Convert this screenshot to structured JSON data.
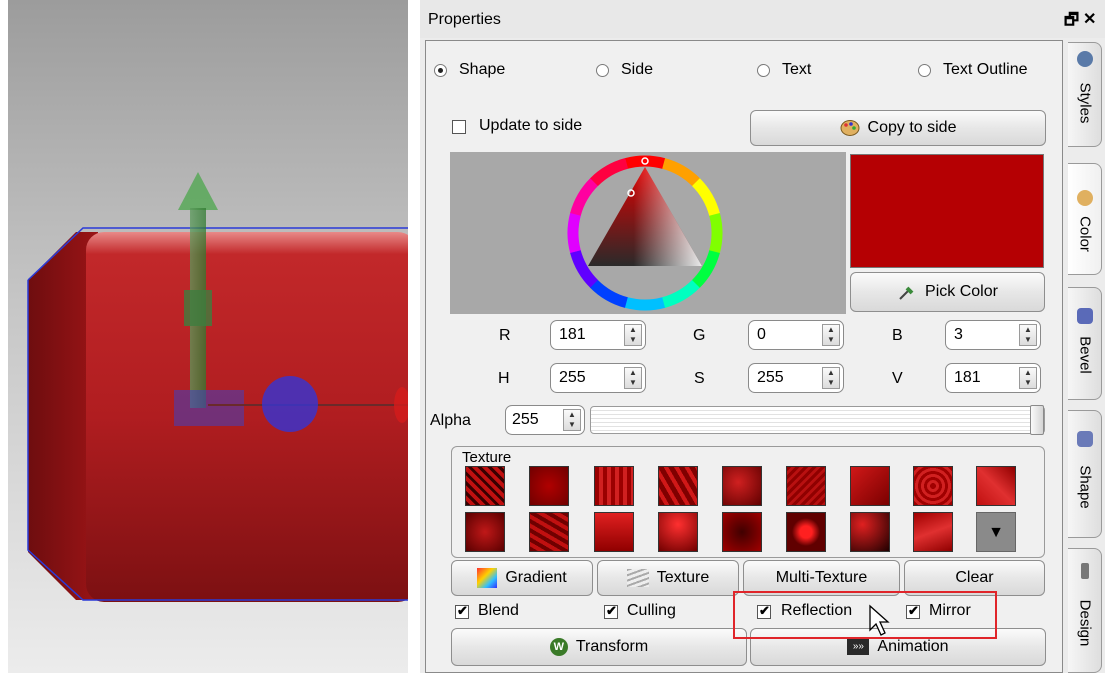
{
  "panel": {
    "title": "Properties",
    "float_glyph": "🗗",
    "close_glyph": "✕"
  },
  "target_radios": [
    {
      "label": "Shape",
      "selected": true
    },
    {
      "label": "Side",
      "selected": false
    },
    {
      "label": "Text",
      "selected": false
    },
    {
      "label": "Text Outline",
      "selected": false
    }
  ],
  "update_to_side": {
    "label": "Update to side",
    "checked": false
  },
  "copy_to_side": {
    "label": "Copy to side"
  },
  "color": {
    "preview_hex": "#b50003",
    "pick_color_label": "Pick Color",
    "r_label": "R",
    "r_value": "181",
    "g_label": "G",
    "g_value": "0",
    "b_label": "B",
    "b_value": "3",
    "h_label": "H",
    "h_value": "255",
    "s_label": "S",
    "s_value": "255",
    "v_label": "V",
    "v_value": "181",
    "alpha_label": "Alpha",
    "alpha_value": "255",
    "alpha_level": 1.0
  },
  "texture": {
    "group_label": "Texture",
    "more_glyph": "▼"
  },
  "texture_buttons": {
    "gradient": "Gradient",
    "texture": "Texture",
    "multi_texture": "Multi-Texture",
    "clear": "Clear"
  },
  "checks": [
    {
      "label": "Blend",
      "checked": true
    },
    {
      "label": "Culling",
      "checked": true
    },
    {
      "label": "Reflection",
      "checked": true
    },
    {
      "label": "Mirror",
      "checked": true
    }
  ],
  "bottom_buttons": {
    "transform": "Transform",
    "animation": "Animation"
  },
  "side_tabs": [
    "Styles",
    "Color",
    "Bevel",
    "Shape",
    "Design"
  ],
  "colors": {
    "accent_red": "#b50003",
    "highlight_box": "#e0252a"
  }
}
